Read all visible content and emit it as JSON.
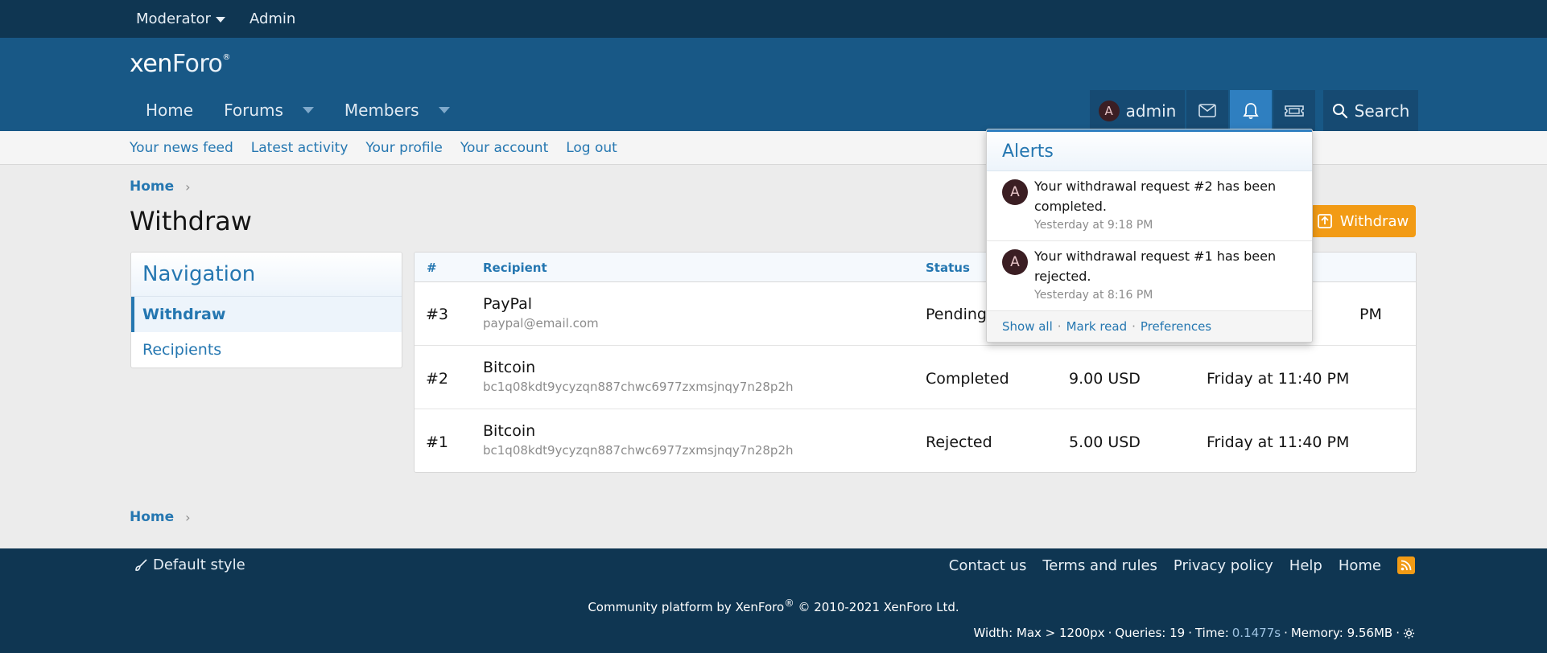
{
  "staffbar": {
    "moderator": "Moderator",
    "admin": "Admin"
  },
  "header": {
    "logo_xen": "xen",
    "logo_foro": "Foro",
    "logo_reg": "®",
    "nav": [
      {
        "label": "Home"
      },
      {
        "label": "Forums"
      },
      {
        "label": "Members"
      }
    ],
    "user": {
      "avatar_letter": "A",
      "name": "admin"
    },
    "search_label": "Search"
  },
  "subnav": [
    "Your news feed",
    "Latest activity",
    "Your profile",
    "Your account",
    "Log out"
  ],
  "breadcrumb": {
    "home": "Home",
    "chevron": "›"
  },
  "page": {
    "title": "Withdraw",
    "withdraw_button": "Withdraw"
  },
  "navigation": {
    "title": "Navigation",
    "items": [
      {
        "label": "Withdraw",
        "selected": true
      },
      {
        "label": "Recipients",
        "selected": false
      }
    ]
  },
  "table": {
    "headers": {
      "num": "#",
      "recipient": "Recipient",
      "status": "Status"
    },
    "rows": [
      {
        "num": "#3",
        "recipient": "PayPal",
        "address": "paypal@email.com",
        "status": "Pending",
        "amount": "",
        "date": "PM"
      },
      {
        "num": "#2",
        "recipient": "Bitcoin",
        "address": "bc1q08kdt9ycyzqn887chwc6977zxmsjnqy7n28p2h",
        "status": "Completed",
        "amount": "9.00 USD",
        "date": "Friday at 11:40 PM"
      },
      {
        "num": "#1",
        "recipient": "Bitcoin",
        "address": "bc1q08kdt9ycyzqn887chwc6977zxmsjnqy7n28p2h",
        "status": "Rejected",
        "amount": "5.00 USD",
        "date": "Friday at 11:40 PM"
      }
    ]
  },
  "alerts": {
    "title": "Alerts",
    "items": [
      {
        "avatar": "A",
        "text": "Your withdrawal request #2 has been completed.",
        "time": "Yesterday at 9:18 PM"
      },
      {
        "avatar": "A",
        "text": "Your withdrawal request #1 has been rejected.",
        "time": "Yesterday at 8:16 PM"
      }
    ],
    "footer": {
      "show_all": "Show all",
      "mark_read": "Mark read",
      "preferences": "Preferences",
      "sep": "·"
    }
  },
  "footer": {
    "style": "Default style",
    "links": [
      "Contact us",
      "Terms and rules",
      "Privacy policy",
      "Help",
      "Home"
    ],
    "copyright_a": "Community platform by XenForo",
    "copyright_reg": "®",
    "copyright_b": " © 2010-2021 XenForo Ltd.",
    "debug": {
      "width": "Width: Max > 1200px",
      "queries": "Queries: 19",
      "time_label": "Time:",
      "time_value": "0.1477s",
      "memory": "Memory: 9.56MB",
      "sep": "·"
    }
  },
  "colors": {
    "staff_bg": "#0f3652",
    "header_bg": "#185886",
    "link": "#2577b1",
    "accent": "#f29b15"
  }
}
